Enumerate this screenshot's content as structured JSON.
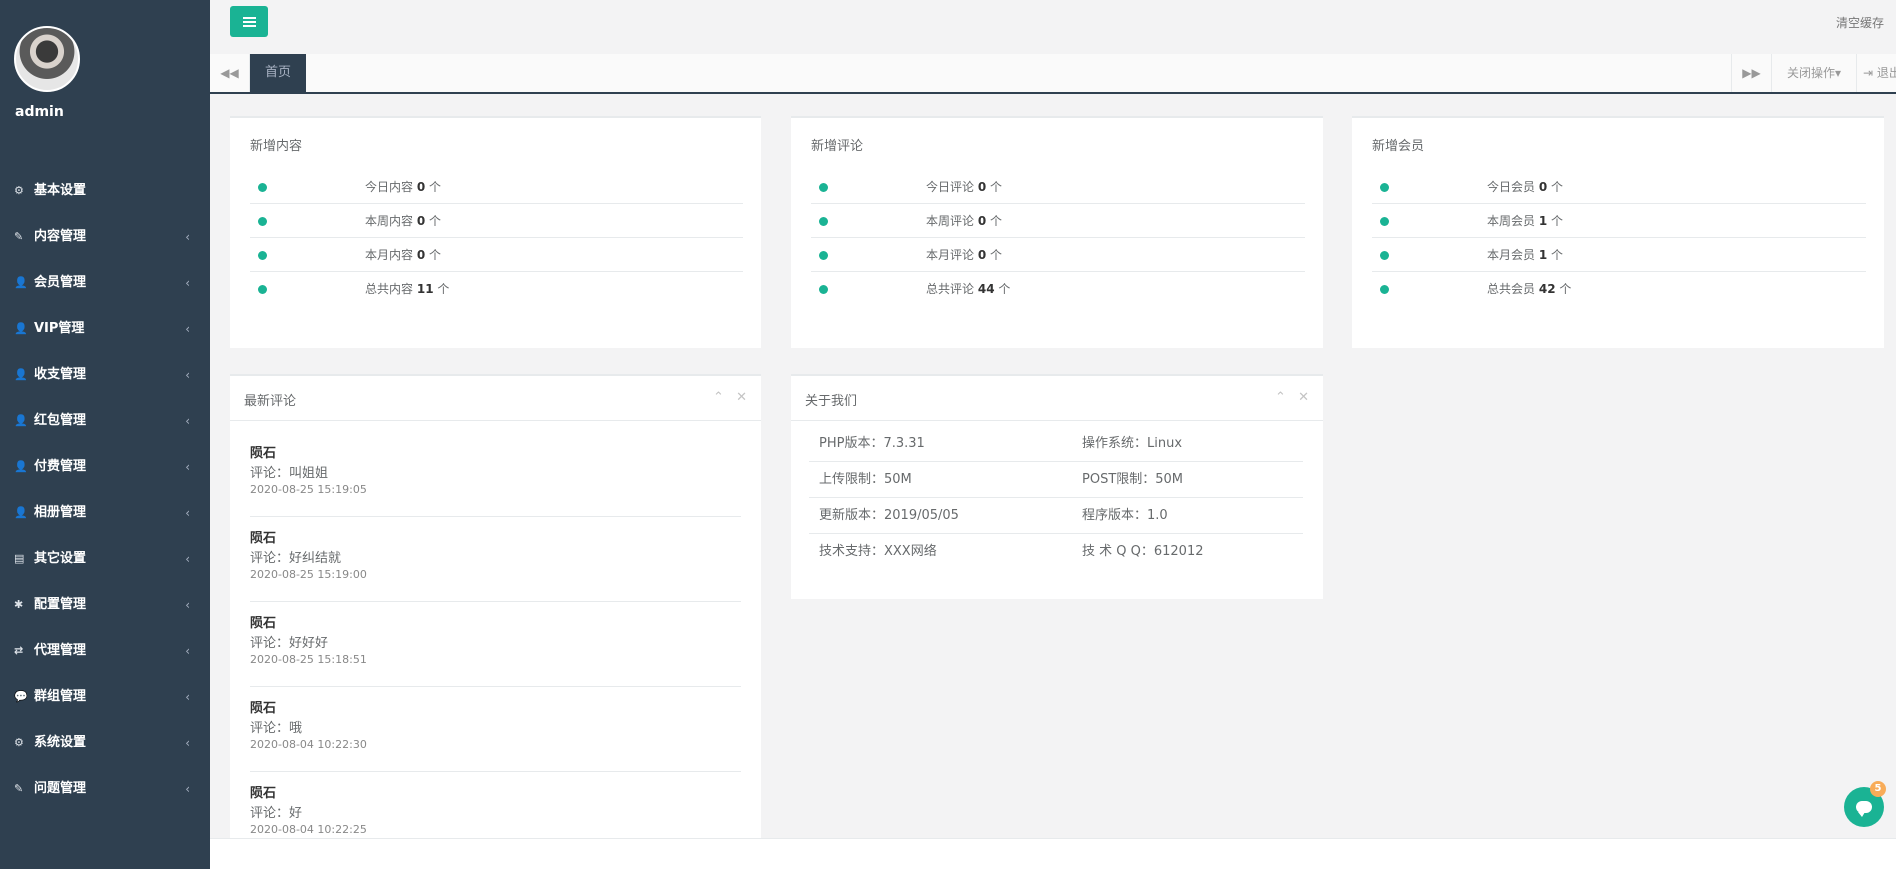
{
  "profile": {
    "name": "admin"
  },
  "sidebar": {
    "items": [
      {
        "label": "基本设置",
        "icon": "⚙",
        "chevron": ""
      },
      {
        "label": "内容管理",
        "icon": "✎",
        "chevron": "‹"
      },
      {
        "label": "会员管理",
        "icon": "👤",
        "chevron": "‹"
      },
      {
        "label": "VIP管理",
        "icon": "👤",
        "chevron": "‹"
      },
      {
        "label": "收支管理",
        "icon": "👤",
        "chevron": "‹"
      },
      {
        "label": "红包管理",
        "icon": "👤",
        "chevron": "‹"
      },
      {
        "label": "付费管理",
        "icon": "👤",
        "chevron": "‹"
      },
      {
        "label": "相册管理",
        "icon": "👤",
        "chevron": "‹"
      },
      {
        "label": "其它设置",
        "icon": "▤",
        "chevron": "‹"
      },
      {
        "label": "配置管理",
        "icon": "✱",
        "chevron": "‹"
      },
      {
        "label": "代理管理",
        "icon": "⇄",
        "chevron": "‹"
      },
      {
        "label": "群组管理",
        "icon": "💬",
        "chevron": "‹"
      },
      {
        "label": "系统设置",
        "icon": "⚙",
        "chevron": "‹"
      },
      {
        "label": "问题管理",
        "icon": "✎",
        "chevron": "‹"
      }
    ]
  },
  "topbar": {
    "clear_cache": "清空缓存"
  },
  "tabs": {
    "home": "首页",
    "close_ops": "关闭操作▾",
    "logout": "⇥ 退出"
  },
  "stats": [
    {
      "title": "新增内容",
      "rows": [
        {
          "label": "今日内容",
          "value": "0",
          "unit": "个"
        },
        {
          "label": "本周内容",
          "value": "0",
          "unit": "个"
        },
        {
          "label": "本月内容",
          "value": "0",
          "unit": "个"
        },
        {
          "label": "总共内容",
          "value": "11",
          "unit": "个"
        }
      ]
    },
    {
      "title": "新增评论",
      "rows": [
        {
          "label": "今日评论",
          "value": "0",
          "unit": "个"
        },
        {
          "label": "本周评论",
          "value": "0",
          "unit": "个"
        },
        {
          "label": "本月评论",
          "value": "0",
          "unit": "个"
        },
        {
          "label": "总共评论",
          "value": "44",
          "unit": "个"
        }
      ]
    },
    {
      "title": "新增会员",
      "rows": [
        {
          "label": "今日会员",
          "value": "0",
          "unit": "个"
        },
        {
          "label": "本周会员",
          "value": "1",
          "unit": "个"
        },
        {
          "label": "本月会员",
          "value": "1",
          "unit": "个"
        },
        {
          "label": "总共会员",
          "value": "42",
          "unit": "个"
        }
      ]
    }
  ],
  "latest_comments": {
    "title": "最新评论",
    "items": [
      {
        "author": "陨石",
        "content": "评论：叫姐姐",
        "time": "2020-08-25 15:19:05"
      },
      {
        "author": "陨石",
        "content": "评论：好纠结就",
        "time": "2020-08-25 15:19:00"
      },
      {
        "author": "陨石",
        "content": "评论：好好好",
        "time": "2020-08-25 15:18:51"
      },
      {
        "author": "陨石",
        "content": "评论：哦",
        "time": "2020-08-04 10:22:30"
      },
      {
        "author": "陨石",
        "content": "评论：好",
        "time": "2020-08-04 10:22:25"
      }
    ]
  },
  "about": {
    "title": "关于我们",
    "rows": [
      [
        "PHP版本：7.3.31",
        "操作系统：Linux"
      ],
      [
        "上传限制：50M",
        "POST限制：50M"
      ],
      [
        "更新版本：2019/05/05",
        "程序版本：1.0"
      ],
      [
        "技术支持：XXX网络",
        "技 术 Q Q：612012"
      ]
    ]
  },
  "panel_controls": {
    "collapse": "⌃",
    "close": "✕"
  },
  "chat": {
    "badge": "5"
  },
  "colors": {
    "sidebar": "#2f4050",
    "accent": "#1ab394",
    "badge": "#f8ac59"
  }
}
